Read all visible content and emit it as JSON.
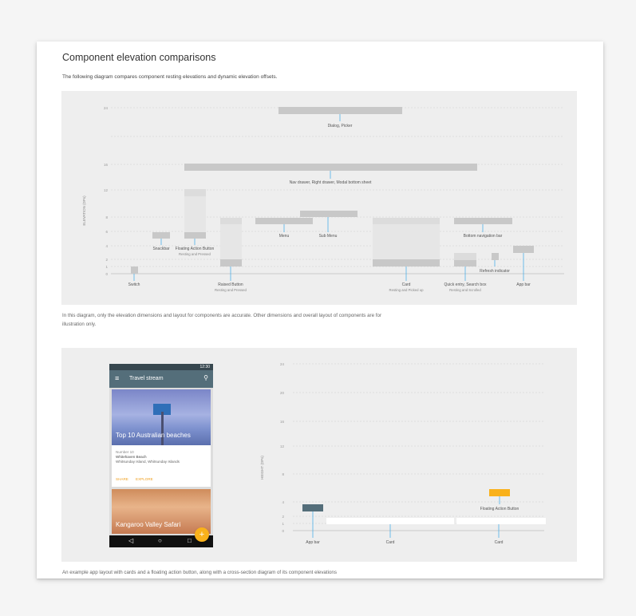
{
  "page": {
    "title": "Component elevation comparisons",
    "subtitle": "The following diagram compares component resting elevations and dynamic elevation offsets.",
    "caption1": "In this diagram, only the elevation dimensions and layout for components are accurate. Other dimensions and overall layout of components are for illustration only.",
    "caption2": "An example app layout with cards and a floating action button, along with a cross-section diagram of its component elevations"
  },
  "diagram1": {
    "axis_label": "ELEVATION (DPs)",
    "ticks": [
      "0",
      "1",
      "2",
      "3",
      "4",
      "6",
      "8",
      "9",
      "12",
      "16",
      "24"
    ],
    "labels": {
      "dialog": "Dialog, Picker",
      "nav_drawer": "Nav drawer, Right drawer, Modal bottom sheet",
      "menu": "Menu",
      "sub_menu": "Sub Menu",
      "bottom_nav": "Bottom navigation bar",
      "snackbar": "Snackbar",
      "fab": "Floating Action Button",
      "fab_sub": "Resting and Pressed",
      "refresh": "Refresh indicator",
      "switch": "Switch",
      "raised": "Raised Button",
      "raised_sub": "Resting and Pressed",
      "card": "Card",
      "card_sub": "Resting and Picked up",
      "quick": "Quick entry, Search box",
      "quick_sub": "Resting and Scrolled",
      "appbar": "App bar"
    }
  },
  "phone": {
    "time": "12:30",
    "app_title": "Travel stream",
    "menu_icon": "menu-icon",
    "search_icon": "search-icon",
    "card1_title": "Top 10 Australian beaches",
    "card1_line1": "Number 10",
    "card1_line2": "Whitehaven Beach",
    "card1_line3": "Whitsunday Island, Whitsunday Islands",
    "action_share": "SHARE",
    "action_explore": "EXPLORE",
    "card2_title": "Kangaroo Valley Safari",
    "fab_symbol": "+",
    "nav_back": "◁",
    "nav_home": "○",
    "nav_recent": "□"
  },
  "diagram2": {
    "axis_label": "HEIGHT (DPs)",
    "ticks": [
      "0",
      "1",
      "2",
      "4",
      "6",
      "8",
      "12",
      "16",
      "20",
      "24"
    ],
    "labels": {
      "appbar": "App bar",
      "card1": "Card",
      "card2": "Card",
      "fab": "Floating Action Button"
    },
    "colors": {
      "appbar": "#546e7a",
      "fab": "#f9b11b",
      "card": "#ffffff"
    }
  }
}
